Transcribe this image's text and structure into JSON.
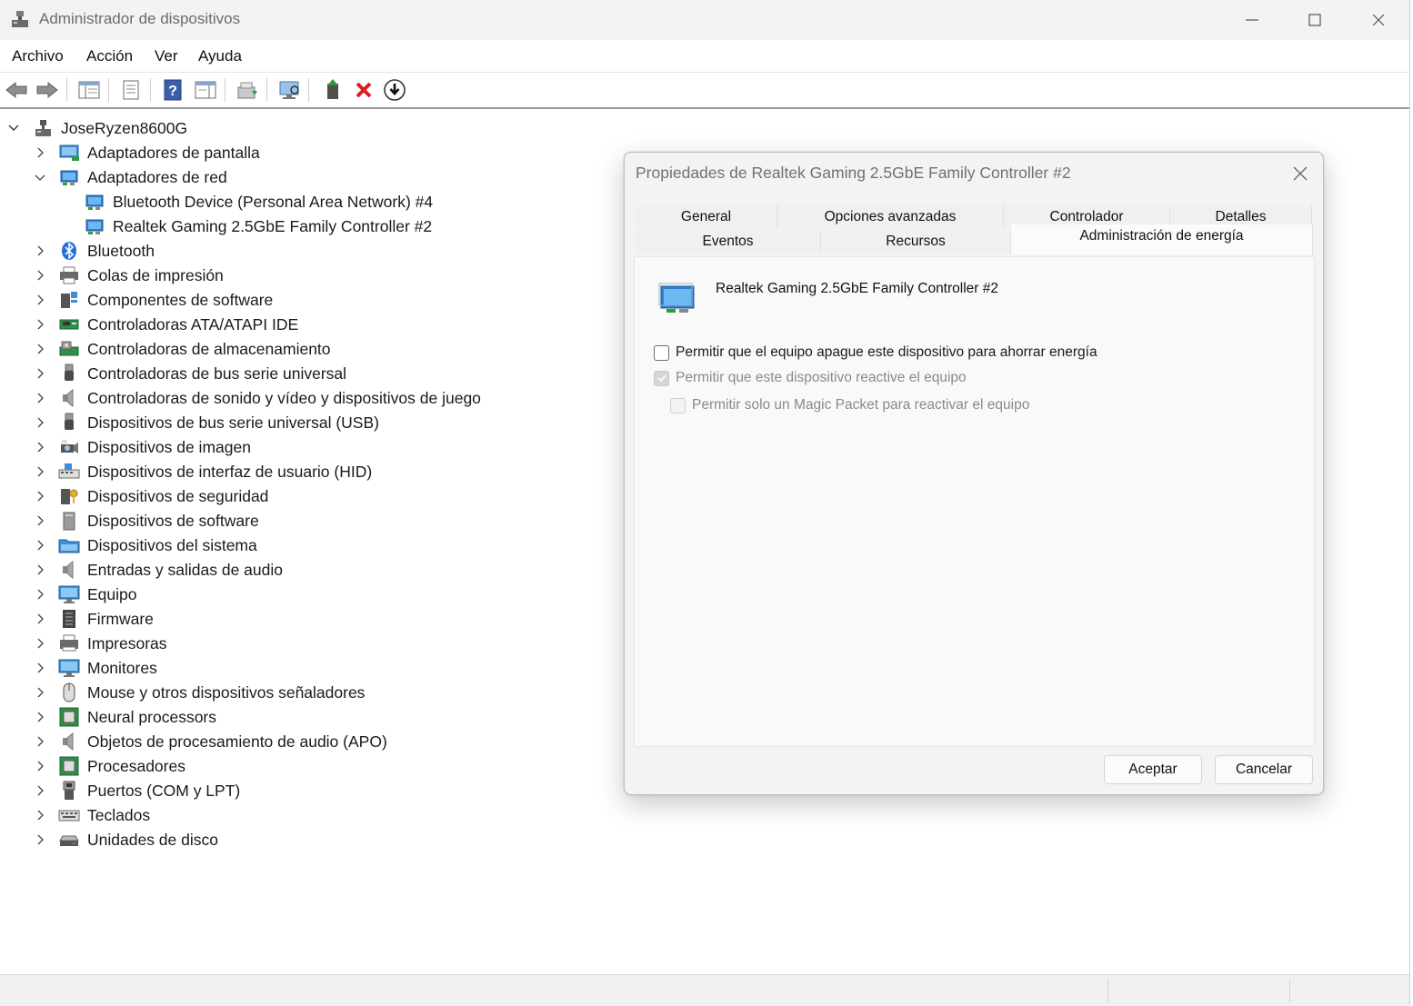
{
  "window": {
    "title": "Administrador de dispositivos"
  },
  "menu": [
    "Archivo",
    "Acción",
    "Ver",
    "Ayuda"
  ],
  "tree": {
    "root": "JoseRyzen8600G",
    "items": [
      {
        "label": "Adaptadores de pantalla",
        "icon": "display-adapter-icon"
      },
      {
        "label": "Adaptadores de red",
        "icon": "network-adapter-icon",
        "expanded": true,
        "children": [
          {
            "label": "Bluetooth Device (Personal Area Network) #4",
            "icon": "network-adapter-icon"
          },
          {
            "label": "Realtek Gaming 2.5GbE Family Controller #2",
            "icon": "network-adapter-icon"
          }
        ]
      },
      {
        "label": "Bluetooth",
        "icon": "bluetooth-icon"
      },
      {
        "label": "Colas de impresión",
        "icon": "print-queue-icon"
      },
      {
        "label": "Componentes de software",
        "icon": "software-component-icon"
      },
      {
        "label": "Controladoras ATA/ATAPI IDE",
        "icon": "ide-controller-icon"
      },
      {
        "label": "Controladoras de almacenamiento",
        "icon": "storage-controller-icon"
      },
      {
        "label": "Controladoras de bus serie universal",
        "icon": "usb-icon"
      },
      {
        "label": "Controladoras de sonido y vídeo y dispositivos de juego",
        "icon": "speaker-icon"
      },
      {
        "label": "Dispositivos de bus serie universal (USB)",
        "icon": "usb-icon"
      },
      {
        "label": "Dispositivos de imagen",
        "icon": "camera-icon"
      },
      {
        "label": "Dispositivos de interfaz de usuario (HID)",
        "icon": "hid-icon"
      },
      {
        "label": "Dispositivos de seguridad",
        "icon": "security-key-icon"
      },
      {
        "label": "Dispositivos de software",
        "icon": "software-device-icon"
      },
      {
        "label": "Dispositivos del sistema",
        "icon": "system-folder-icon"
      },
      {
        "label": "Entradas y salidas de audio",
        "icon": "speaker-icon"
      },
      {
        "label": "Equipo",
        "icon": "monitor-icon"
      },
      {
        "label": "Firmware",
        "icon": "firmware-icon"
      },
      {
        "label": "Impresoras",
        "icon": "printer-icon"
      },
      {
        "label": "Monitores",
        "icon": "monitor-icon"
      },
      {
        "label": "Mouse y otros dispositivos señaladores",
        "icon": "mouse-icon"
      },
      {
        "label": "Neural processors",
        "icon": "chip-icon"
      },
      {
        "label": "Objetos de procesamiento de audio (APO)",
        "icon": "speaker-icon"
      },
      {
        "label": "Procesadores",
        "icon": "chip-icon"
      },
      {
        "label": "Puertos (COM y LPT)",
        "icon": "port-icon"
      },
      {
        "label": "Teclados",
        "icon": "keyboard-icon"
      },
      {
        "label": "Unidades de disco",
        "icon": "disk-drive-icon"
      }
    ]
  },
  "dialog": {
    "title": "Propiedades de Realtek Gaming 2.5GbE Family Controller #2",
    "tabs_row1": [
      "General",
      "Opciones avanzadas",
      "Controlador",
      "Detalles"
    ],
    "tabs_row2": [
      "Eventos",
      "Recursos",
      "Administración de energía"
    ],
    "active_tab": "Administración de energía",
    "device_name": "Realtek Gaming 2.5GbE Family Controller #2",
    "options": [
      {
        "label": "Permitir que el equipo apague este dispositivo para ahorrar energía",
        "checked": false,
        "enabled": true
      },
      {
        "label": "Permitir que este dispositivo reactive el equipo",
        "checked": true,
        "enabled": false
      },
      {
        "label": "Permitir solo un Magic Packet para reactivar el equipo",
        "checked": false,
        "enabled": false
      }
    ],
    "ok_label": "Aceptar",
    "cancel_label": "Cancelar"
  }
}
